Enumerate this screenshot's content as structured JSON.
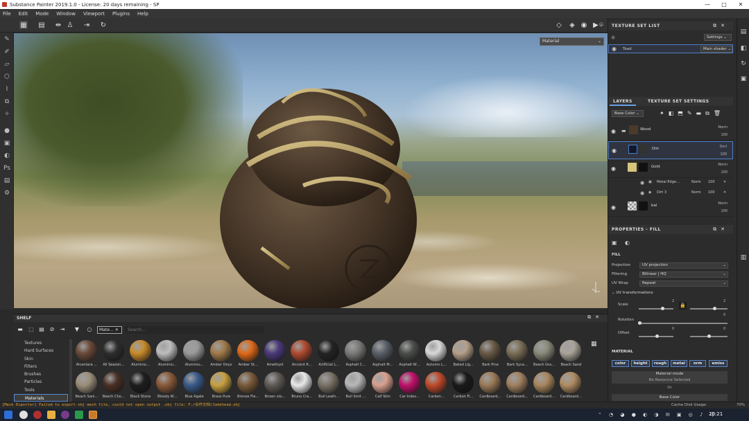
{
  "window": {
    "title": "Substance Painter 2019.1.0 - License: 20 days remaining - SP",
    "controls": [
      "—",
      "□",
      "✕"
    ]
  },
  "menu": [
    "File",
    "Edit",
    "Mode",
    "Window",
    "Viewport",
    "Plugins",
    "Help"
  ],
  "viewport": {
    "mode_dropdown": "Material"
  },
  "texture_set_list": {
    "title": "TEXTURE SET LIST",
    "settings_label": "Settings",
    "set_name": "Toad",
    "shader": "Main shader"
  },
  "layers": {
    "tabs": [
      "LAYERS",
      "TEXTURE SET SETTINGS"
    ],
    "channel_dropdown": "Base Color",
    "items": [
      {
        "name": "Wood",
        "blend": "Norm",
        "opacity": "100",
        "kind": "folder"
      },
      {
        "name": "Dirt",
        "blend": "Ovrl",
        "opacity": "100",
        "kind": "fill",
        "selected": true
      },
      {
        "name": "Gold",
        "blend": "Norm",
        "opacity": "100",
        "kind": "fill"
      },
      {
        "name": "bal",
        "blend": "Norm",
        "opacity": "100",
        "kind": "fill"
      }
    ],
    "effects": [
      {
        "name": "Metal Edge…",
        "blend": "Norm",
        "opacity": "100"
      },
      {
        "name": "Dirt 3",
        "blend": "Norm",
        "opacity": "100"
      }
    ]
  },
  "properties": {
    "title": "PROPERTIES - FILL",
    "section_fill": "FILL",
    "projection_label": "Projection",
    "projection_value": "UV projection",
    "filtering_label": "Filtering",
    "filtering_value": "Bilinear | HQ",
    "uvwrap_label": "UV Wrap",
    "uvwrap_value": "Repeat",
    "uvtrans_label": "UV transformations",
    "scale_label": "Scale",
    "scale_value_a": "2",
    "scale_value_b": "2",
    "rotation_label": "Rotation",
    "rotation_value": "0",
    "offset_label": "Offset",
    "offset_value_a": "0",
    "offset_value_b": "0",
    "section_material": "MATERIAL",
    "channels": [
      "color",
      "height",
      "rough",
      "metal",
      "nrm",
      "emiss"
    ],
    "material_mode": "Material mode",
    "no_resource": "No Resource Selected",
    "or_text": "Or",
    "base_color": "Base Color"
  },
  "shelf": {
    "title": "SHELF",
    "filter_tag": "Mate…",
    "search_placeholder": "Search...",
    "categories": [
      "Textures",
      "Hard Surfaces",
      "Skin",
      "Filters",
      "Brushes",
      "Particles",
      "Tools",
      "Materials"
    ],
    "active_category": "Materials",
    "materials": [
      {
        "name": "Alcantara …",
        "color": "#6a4a3a"
      },
      {
        "name": "All Season…",
        "color": "#2e2e2e"
      },
      {
        "name": "Aluminiu…",
        "color": "#c88a2a"
      },
      {
        "name": "Aluminiu…",
        "color": "#bdbdbd"
      },
      {
        "name": "Aluminiu…",
        "color": "#9a9a9a"
      },
      {
        "name": "Amber Onyx",
        "color": "#a07a4a"
      },
      {
        "name": "Amber St…",
        "color": "#e06a1a"
      },
      {
        "name": "Amethyst",
        "color": "#4a3a7a"
      },
      {
        "name": "Ancient R…",
        "color": "#b04a30"
      },
      {
        "name": "Artificial L…",
        "color": "#242424"
      },
      {
        "name": "Asphalt C…",
        "color": "#7a7a78"
      },
      {
        "name": "Asphalt M…",
        "color": "#5a6068"
      },
      {
        "name": "Asphalt W…",
        "color": "#4a4e4a"
      },
      {
        "name": "Autumn L…",
        "color": "#d9d9d9"
      },
      {
        "name": "Baked Lig…",
        "color": "#b5a08a"
      },
      {
        "name": "Bark Pine",
        "color": "#6a5a46"
      },
      {
        "name": "Bark Syca…",
        "color": "#7a6e56"
      },
      {
        "name": "Beach Gra…",
        "color": "#8a8a7a"
      },
      {
        "name": "Beach Sand",
        "color": "#aaa49a"
      },
      {
        "name": "Beach Sani…",
        "color": "#9a8e7a"
      },
      {
        "name": "Beech Cho…",
        "color": "#4a3024"
      },
      {
        "name": "Black Stone",
        "color": "#1e1e1e"
      },
      {
        "name": "Bloody W…",
        "color": "#8a5a3a"
      },
      {
        "name": "Blue Agate",
        "color": "#3a5a8a"
      },
      {
        "name": "Brass Pure",
        "color": "#c8a040"
      },
      {
        "name": "Bronze Fle…",
        "color": "#7a5a3a"
      },
      {
        "name": "Brown sto…",
        "color": "#5e5a56"
      },
      {
        "name": "Bruno Cra…",
        "color": "#e8e8e8"
      },
      {
        "name": "Bull Leath…",
        "color": "#7a7266"
      },
      {
        "name": "Bull Smit …",
        "color": "#b8b8b8"
      },
      {
        "name": "Calf Skin",
        "color": "#d8a090"
      },
      {
        "name": "Car Indes…",
        "color": "#c0106a"
      },
      {
        "name": "Carbon…",
        "color": "#c04a2a"
      },
      {
        "name": "Carbon Fi…",
        "color": "#1a1a1a"
      },
      {
        "name": "Cardboard…",
        "color": "#9a7a58"
      },
      {
        "name": "Cardboard…",
        "color": "#a08060"
      },
      {
        "name": "Cardboard…",
        "color": "#a8865e"
      },
      {
        "name": "Cardboard…",
        "color": "#b08c62"
      }
    ]
  },
  "status": {
    "error": "[Mesh Exporter] Failed to export obj mesh file, could not open output .obj file: F:/合作文档/Jadehead.obj",
    "cache": "Cache Disk Usage:",
    "cache_pct": "70%"
  },
  "taskbar": {
    "time": "20:21"
  }
}
